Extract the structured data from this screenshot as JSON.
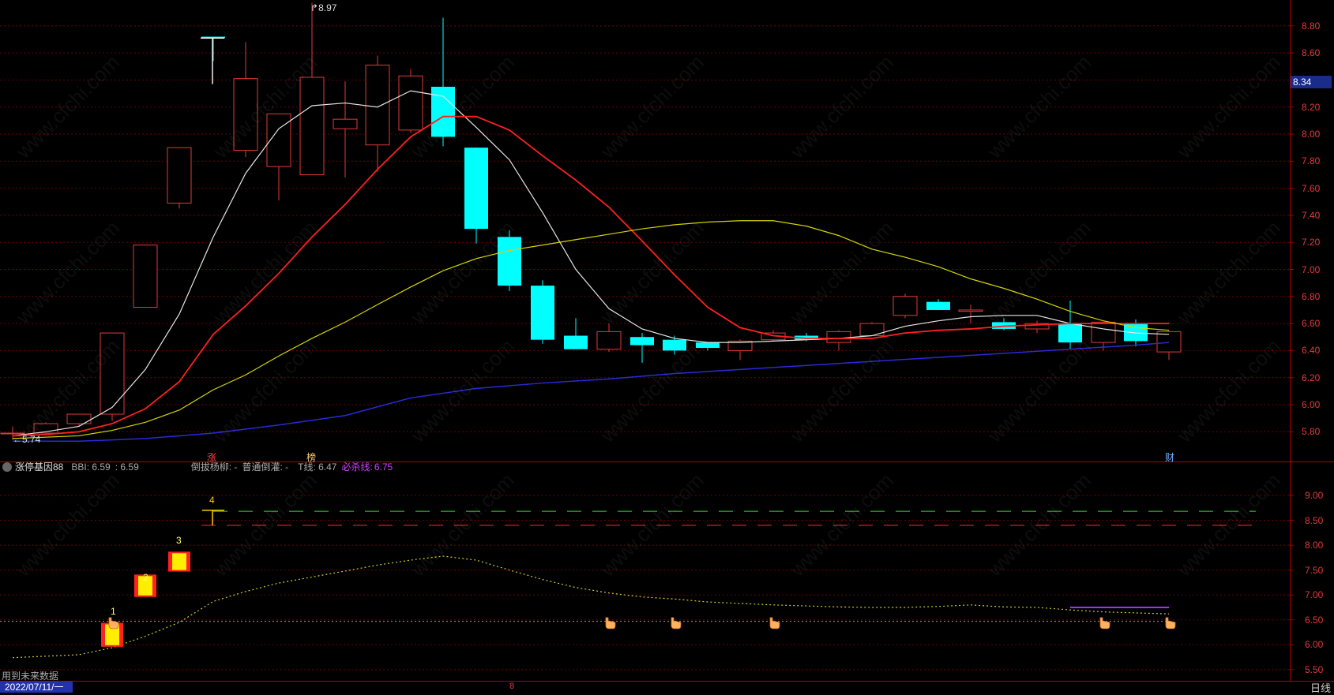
{
  "watermark": "www.cfchi.com",
  "price_axis": {
    "labels": [
      "8.80",
      "8.60",
      "8.40",
      "8.20",
      "8.00",
      "7.80",
      "7.60",
      "7.40",
      "7.20",
      "7.00",
      "6.80",
      "6.60",
      "6.40",
      "6.20",
      "6.00",
      "5.80"
    ],
    "current_price": "8.34"
  },
  "indicator_axis": {
    "labels": [
      "9.00",
      "8.50",
      "8.00",
      "7.50",
      "7.00",
      "6.50",
      "6.00",
      "5.50"
    ]
  },
  "annotations": {
    "high_label": "8.97",
    "low_label": "5.74",
    "mark_zhang": "涨",
    "mark_bang": "榜",
    "mark_cai": "财"
  },
  "indicator_bar": {
    "name": "涨停基因88",
    "bbi_label": "BBI: 6.59",
    "second_value": ": 6.59",
    "daobang": "倒拔杨柳: -",
    "putong": "普通倒灌: -",
    "tline": "T线: 6.47",
    "bisha_label": "必杀线:",
    "bisha_value": "6.75"
  },
  "signal_numbers": [
    "1",
    "2",
    "3",
    "4"
  ],
  "footer": {
    "note": "用到未来数据",
    "date": "2022/07/11/一",
    "period": "日线",
    "marker": "8"
  },
  "colors": {
    "up": "#e23a3a",
    "down": "#00ffff",
    "ma_white": "#e6e6e6",
    "ma_red": "#ff2020",
    "ma_yellow": "#d4d400",
    "ma_blue": "#2a2ad8",
    "grid": "#6a0000",
    "bisha": "#9933ff"
  }
}
